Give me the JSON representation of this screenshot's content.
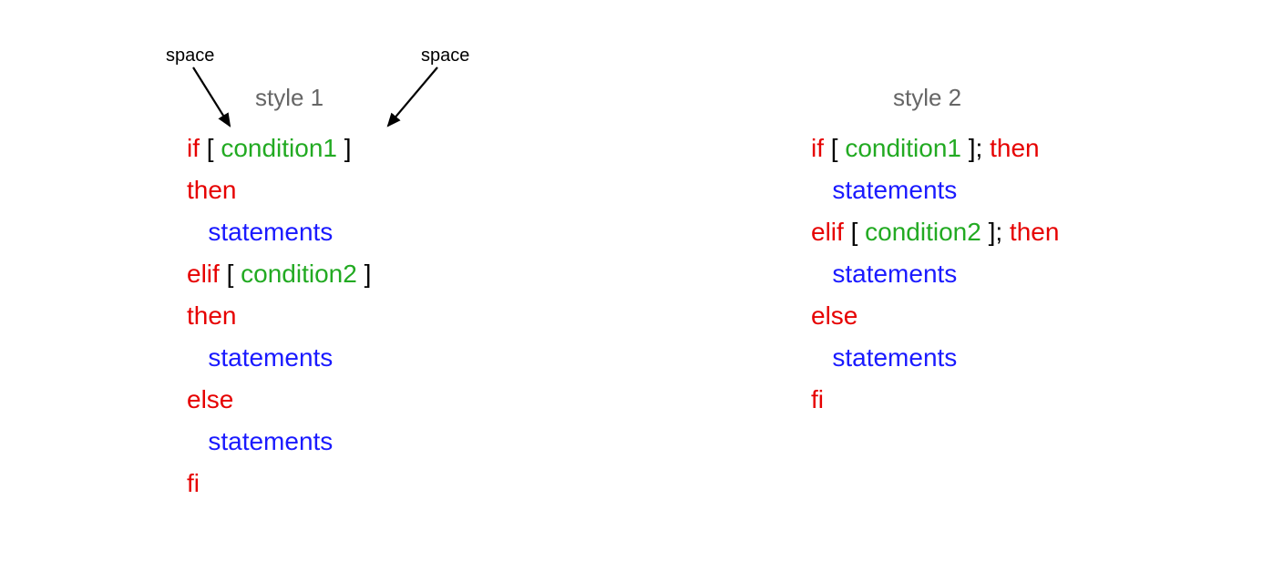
{
  "annotations": {
    "left_label": "space",
    "right_label": "space"
  },
  "titles": {
    "style1": "style 1",
    "style2": "style 2"
  },
  "code": {
    "kw_if": "if",
    "kw_then": "then",
    "kw_elif": "elif",
    "kw_else": "else",
    "kw_fi": "fi",
    "bracket_open": " [ ",
    "bracket_close": " ]",
    "bracket_close_semi": " ]; ",
    "cond1": "condition1",
    "cond2": "condition2",
    "stmts": "statements",
    "indent": "   "
  },
  "colors": {
    "keyword": "#e60000",
    "bracket": "#000000",
    "condition": "#22aa22",
    "statement": "#1a1aff",
    "title": "#666666"
  }
}
